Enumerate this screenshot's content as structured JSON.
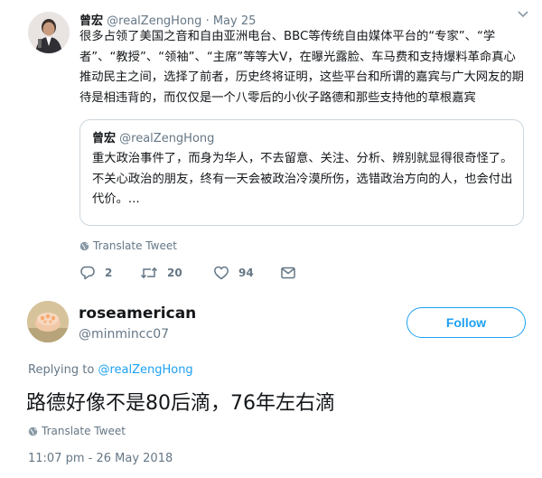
{
  "tweet1": {
    "name": "曾宏",
    "handle": "@realZengHong",
    "separator": "·",
    "date": "May 25",
    "text": "很多占领了美国之音和自由亚洲电台、BBC等传统自由媒体平台的“专家”、“学者”、“教授”、“领袖”、“主席”等等大V，在曝光露脸、车马费和支持爆料革命真心推动民主之间，选择了前者，历史终将证明，这些平台和所谓的嘉宾与广大网友的期待是相违背的，而仅仅是一个八零后的小伙子路德和那些支持他的草根嘉宾",
    "quote": {
      "name": "曾宏",
      "handle": "@realZengHong",
      "text": "重大政治事件了，而身为华人，不去留意、关注、分析、辨别就显得很奇怪了。\n不关心政治的朋友，终有一天会被政治冷漠所伤，选错政治方向的人，也会付出代价。..."
    },
    "translate_label": "Translate Tweet",
    "actions": {
      "reply_count": "2",
      "retweet_count": "20",
      "like_count": "94"
    },
    "menu_icon": "chevron-down-icon"
  },
  "tweet2": {
    "name": "roseamerican",
    "handle": "@minmincc07",
    "follow_label": "Follow",
    "replying_prefix": "Replying to",
    "replying_to": "@realZengHong",
    "text": "路德好像不是80后滴，76年左右滴",
    "translate_label": "Translate Tweet",
    "timestamp": "11:07 pm - 26 May 2018"
  },
  "colors": {
    "accent": "#1da1f2",
    "muted": "#657786",
    "border": "#ccd6dd",
    "text": "#14171a"
  }
}
